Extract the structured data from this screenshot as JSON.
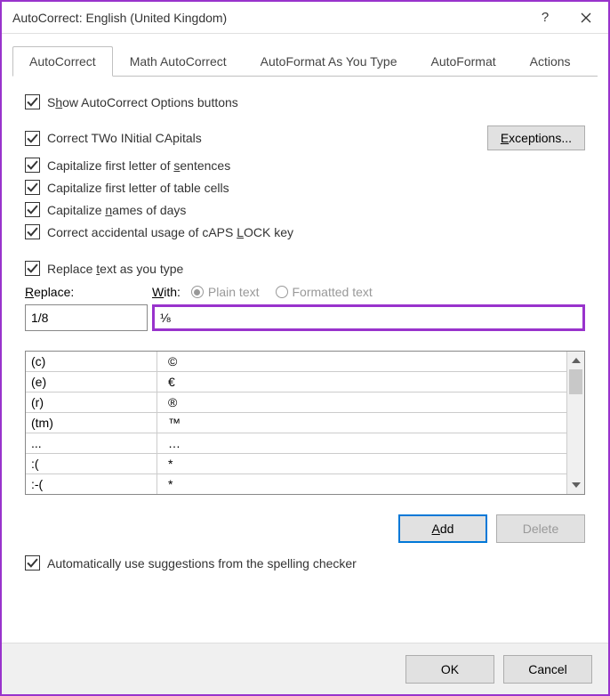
{
  "title": "AutoCorrect: English (United Kingdom)",
  "tabs": [
    "AutoCorrect",
    "Math AutoCorrect",
    "AutoFormat As You Type",
    "AutoFormat",
    "Actions"
  ],
  "active_tab": 0,
  "options": {
    "show_buttons": {
      "pre": "S",
      "u": "h",
      "post": "ow AutoCorrect Options buttons"
    },
    "two_initial": "Correct TWo INitial CApitals",
    "first_sentence": {
      "pre": "Capitalize first letter of ",
      "u": "s",
      "post": "entences"
    },
    "first_cell": "Capitalize first letter of table cells",
    "names_days": {
      "pre": "Capitalize ",
      "u": "n",
      "post": "ames of days"
    },
    "caps_lock": {
      "pre": "Correct accidental usage of cAPS ",
      "u": "L",
      "post": "OCK key"
    },
    "replace_type": {
      "pre": "Replace ",
      "u": "t",
      "post": "ext as you type"
    },
    "auto_suggest": "Automatically use suggestions from the spelling checker"
  },
  "exceptions_label": {
    "u": "E",
    "post": "xceptions..."
  },
  "replace_label": {
    "u": "R",
    "post": "eplace:"
  },
  "with_label": {
    "u": "W",
    "post": "ith:"
  },
  "radio_plain": "Plain text",
  "radio_formatted": "Formatted text",
  "replace_value": "1/8",
  "with_value": "⅛",
  "table_rows": [
    {
      "r": "(c)",
      "w": "©"
    },
    {
      "r": "(e)",
      "w": "€"
    },
    {
      "r": "(r)",
      "w": "®"
    },
    {
      "r": "(tm)",
      "w": "™"
    },
    {
      "r": "...",
      "w": "…"
    },
    {
      "r": ":(",
      "w": "*"
    },
    {
      "r": ":-(",
      "w": "*"
    }
  ],
  "add_label": {
    "u": "A",
    "post": "dd"
  },
  "delete_label": "Delete",
  "ok_label": "OK",
  "cancel_label": "Cancel"
}
